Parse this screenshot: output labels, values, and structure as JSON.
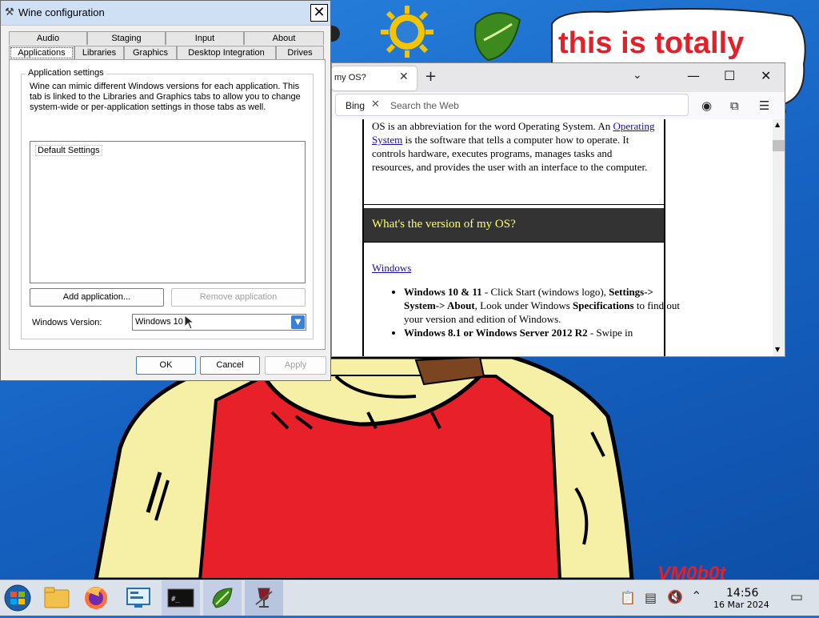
{
  "wine": {
    "title": "Wine configuration",
    "close": "✕",
    "tabs_row1": [
      "Audio",
      "Staging",
      "Input",
      "About"
    ],
    "tabs_row2": [
      "Applications",
      "Libraries",
      "Graphics",
      "Desktop Integration",
      "Drives"
    ],
    "group_title": "Application settings",
    "group_desc": "Wine can mimic different Windows versions for each application. This tab is linked to the Libraries and Graphics tabs to allow you to change system-wide or per-application settings in those tabs as well.",
    "list_items": [
      "Default Settings"
    ],
    "add_button": "Add application...",
    "remove_button": "Remove application",
    "version_label": "Windows Version:",
    "version_value": "Windows 10",
    "ok": "OK",
    "cancel": "Cancel",
    "apply": "Apply"
  },
  "browser": {
    "tab_title": "my OS?",
    "search_engine": "Bing",
    "search_placeholder": "Search the Web",
    "para1_before": "OS is an abbreviation for the word Operating System. An ",
    "para1_link": "Operating System",
    "para1_after": " is the software that tells a computer how to operate. It controls hardware, executes programs, manages tasks and resources, and provides the user with an interface to the computer.",
    "heading": "What's the version of my OS?",
    "windows_link": "Windows",
    "list": [
      {
        "bold": "Windows 10 & 11",
        "text": " - Click Start (windows logo), ",
        "b2": "Settings-> System-> About",
        "t2": ", Look under Windows ",
        "b3": "Specifications",
        "t3": " to find out your version and edition of Windows."
      },
      {
        "bold": "Windows 8.1 or Windows Server 2012 R2",
        "text": " - Swipe in",
        "b2": "",
        "t2": "",
        "b3": "",
        "t3": ""
      }
    ]
  },
  "wallpaper": {
    "speech": "this is totally",
    "signature": "VM0b0t"
  },
  "taskbar": {
    "time": "14:56",
    "date": "16 Mar 2024",
    "terminal_prompt": "#_"
  }
}
